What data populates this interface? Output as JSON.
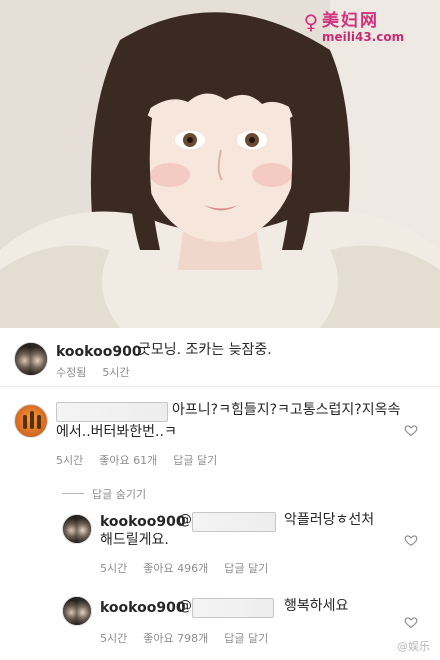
{
  "watermark": {
    "site_name": "美妇网",
    "url": "meili43.com",
    "icon": "woman-silhouette-icon",
    "color": "#d0337d"
  },
  "caption": {
    "username": "kookoo900",
    "text": "굿모닝. 조카는 늦잠중.",
    "edited": "수정됨",
    "time": "5시간"
  },
  "comments": [
    {
      "text_line1": "아프니?ㅋ힘들지?ㅋ고통스럽지?지옥속",
      "text_line2": "에서..버터봐한번..ㅋ",
      "time": "5시간",
      "likes": "좋아요 61개",
      "reply": "답글 달기",
      "icon": "heart-icon"
    }
  ],
  "hide_replies": "답글 숨기기",
  "replies": [
    {
      "username": "kookoo900",
      "mention": "@",
      "text_line1": "악플러당ㅎ선처",
      "text_line2": "해드릴게요.",
      "time": "5시간",
      "likes": "좋아요 496개",
      "reply": "답글 달기",
      "icon": "heart-icon"
    },
    {
      "username": "kookoo900",
      "mention": "@",
      "text_line1": "행복하세요",
      "time": "5시간",
      "likes": "좋아요 798개",
      "reply": "답글 달기",
      "icon": "heart-icon"
    }
  ],
  "footer_watermark": "@娱乐"
}
